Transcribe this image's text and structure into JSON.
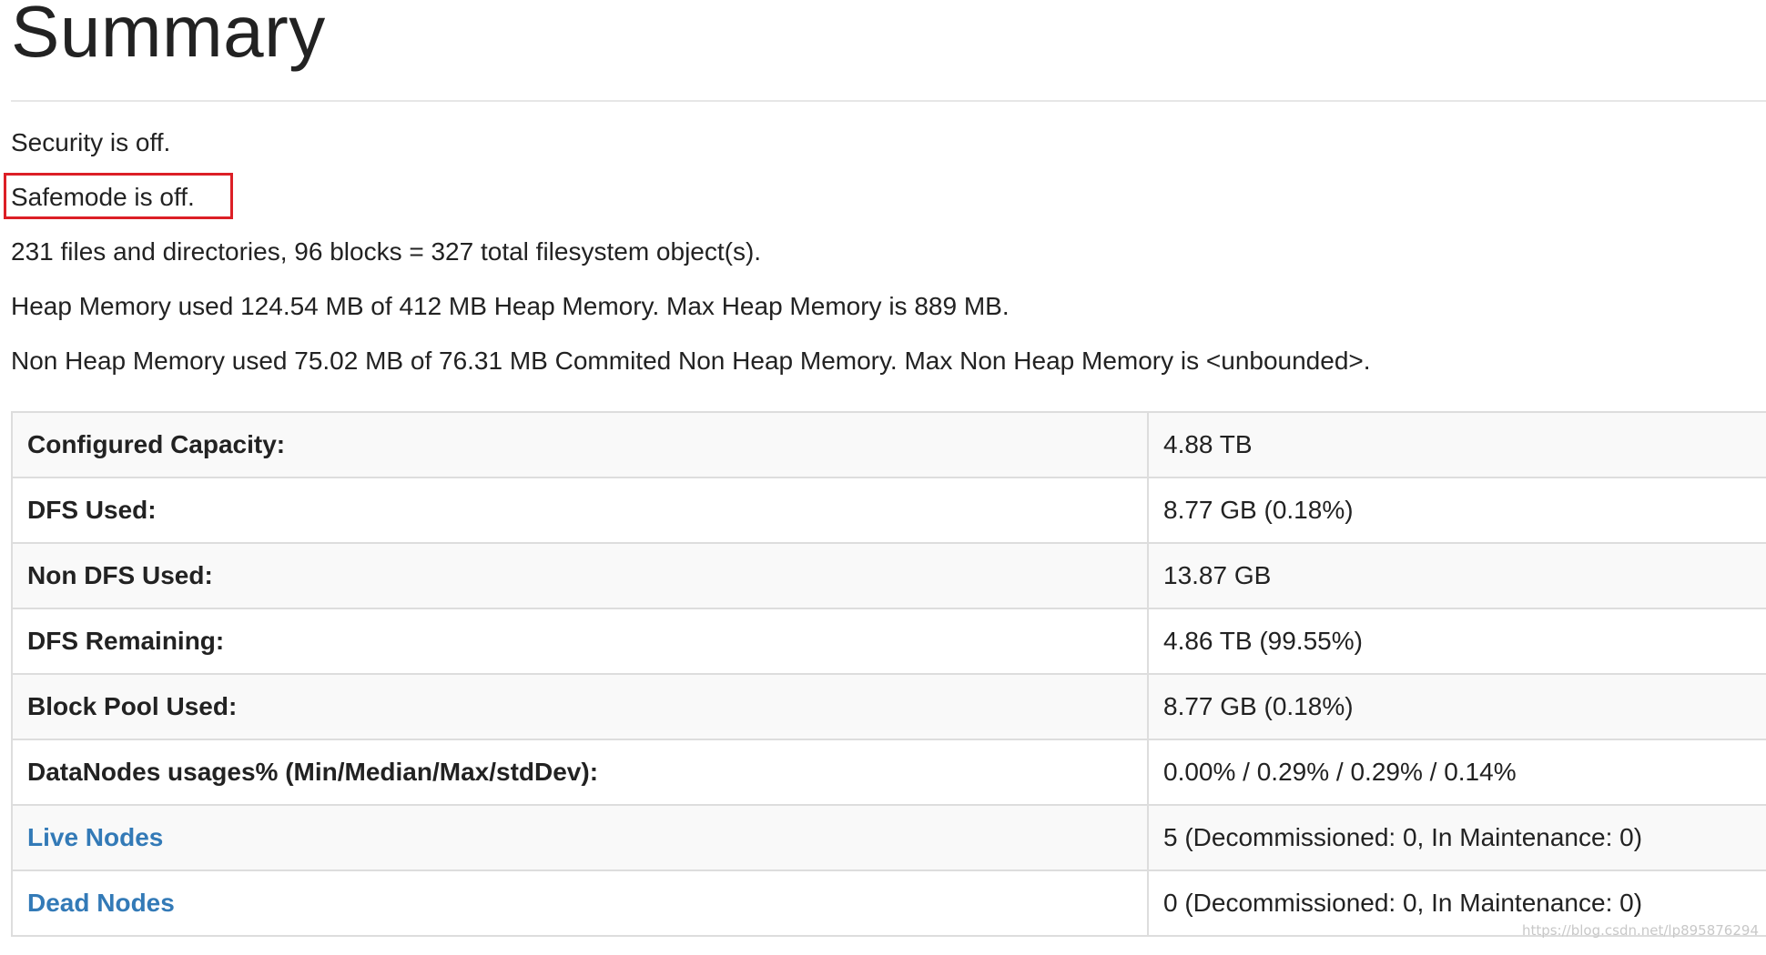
{
  "title": "Summary",
  "status_lines": {
    "security": "Security is off.",
    "safemode": "Safemode is off.",
    "files": "231 files and directories, 96 blocks = 327 total filesystem object(s).",
    "heap": "Heap Memory used 124.54 MB of 412 MB Heap Memory. Max Heap Memory is 889 MB.",
    "non_heap": "Non Heap Memory used 75.02 MB of 76.31 MB Commited Non Heap Memory. Max Non Heap Memory is <unbounded>."
  },
  "highlight_color": "#dc1f26",
  "link_color": "#337ab7",
  "table": {
    "rows": [
      {
        "label": "Configured Capacity:",
        "value": "4.88 TB"
      },
      {
        "label": "DFS Used:",
        "value": "8.77 GB (0.18%)"
      },
      {
        "label": "Non DFS Used:",
        "value": "13.87 GB"
      },
      {
        "label": "DFS Remaining:",
        "value": "4.86 TB (99.55%)"
      },
      {
        "label": "Block Pool Used:",
        "value": "8.77 GB (0.18%)"
      },
      {
        "label": "DataNodes usages% (Min/Median/Max/stdDev):",
        "value": "0.00% / 0.29% / 0.29% / 0.14%"
      },
      {
        "label": "Live Nodes",
        "value": "5 (Decommissioned: 0, In Maintenance: 0)"
      },
      {
        "label": "Dead Nodes",
        "value": "0 (Decommissioned: 0, In Maintenance: 0)"
      }
    ]
  },
  "watermark": "https://blog.csdn.net/lp895876294"
}
